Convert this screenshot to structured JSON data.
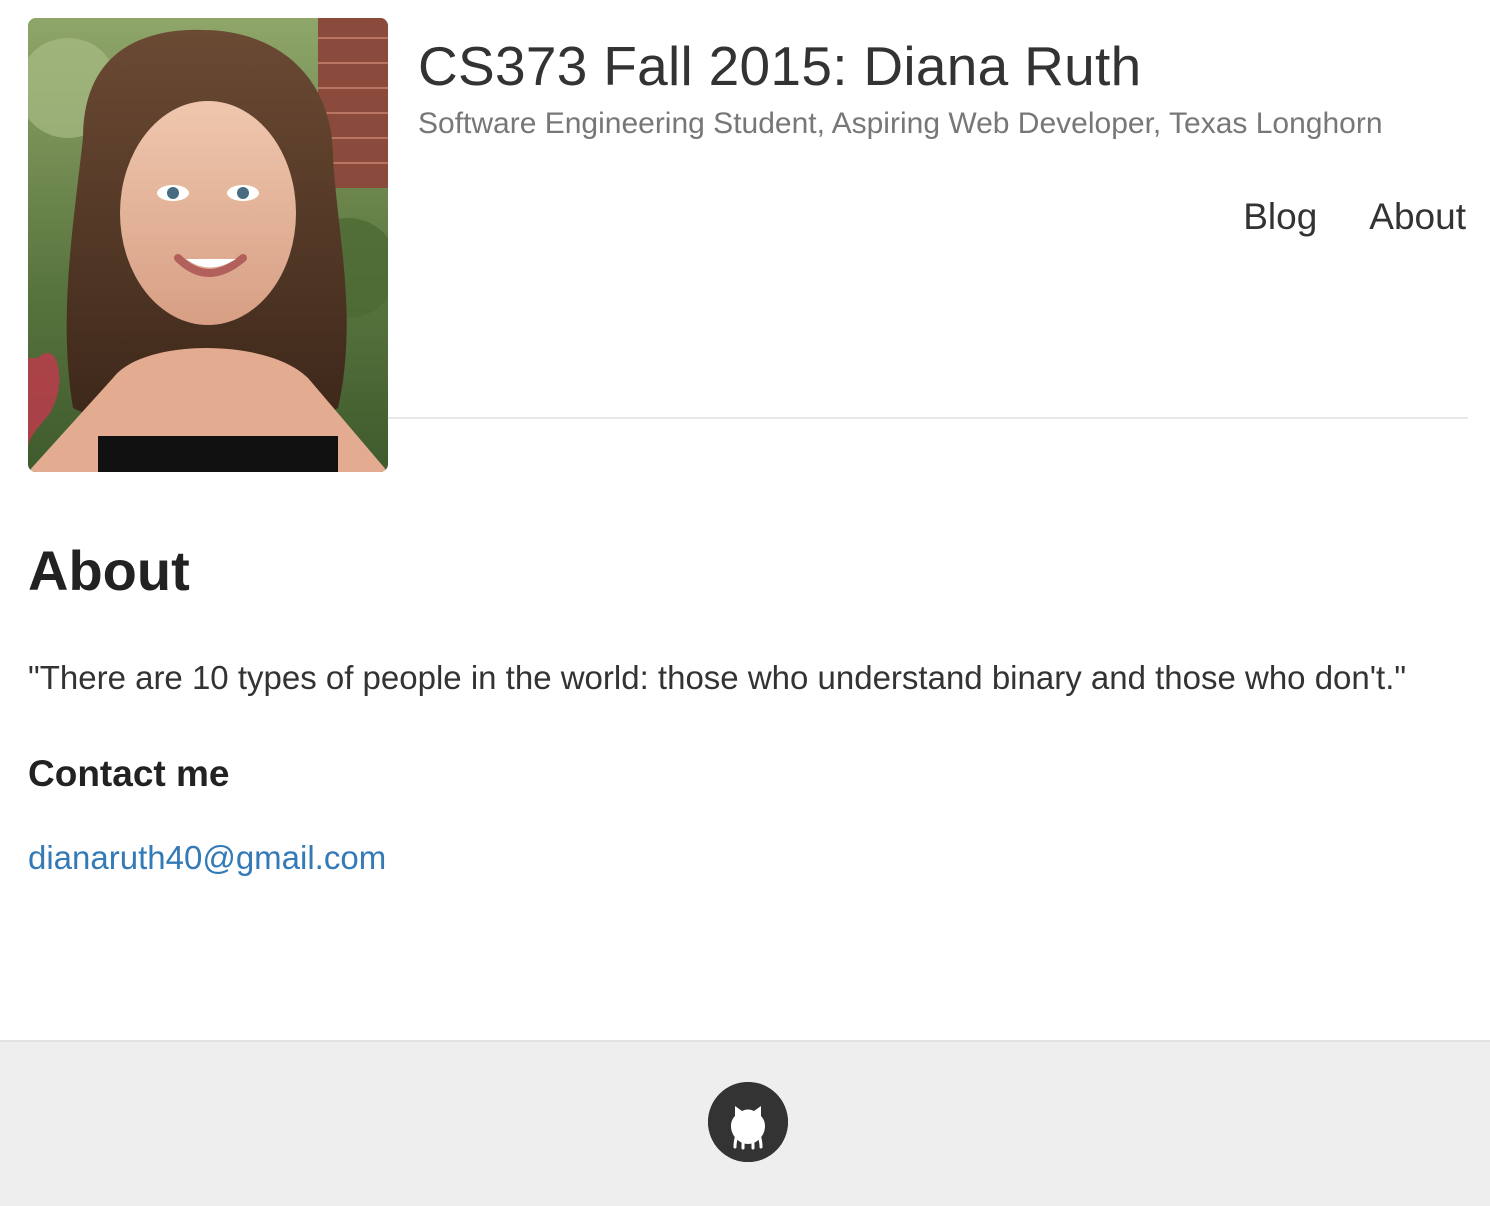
{
  "header": {
    "title": "CS373 Fall 2015: Diana Ruth",
    "tagline": "Software Engineering Student, Aspiring Web Developer, Texas Longhorn",
    "avatar_icon": "profile-photo",
    "nav": [
      {
        "label": "Blog"
      },
      {
        "label": "About"
      }
    ]
  },
  "main": {
    "title": "About",
    "quote": "\"There are 10 types of people in the world: those who understand binary and those who don't.\"",
    "contact_heading": "Contact me",
    "email": "dianaruth40@gmail.com"
  },
  "footer": {
    "icon": "github-icon"
  },
  "colors": {
    "link": "#337ab7",
    "footer_bg": "#eeeeee",
    "icon_circle": "#333333"
  }
}
